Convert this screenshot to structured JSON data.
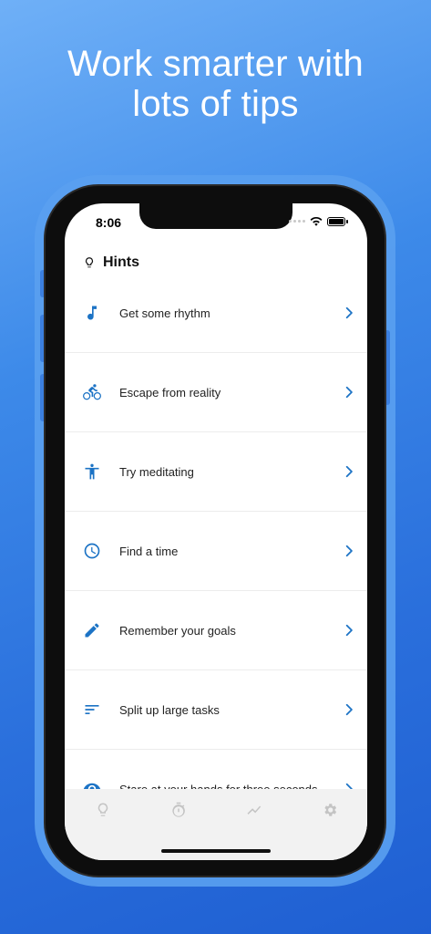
{
  "headline": {
    "line1": "Work smarter with",
    "line2": "lots of tips"
  },
  "status_bar": {
    "time": "8:06"
  },
  "screen": {
    "title": "Hints"
  },
  "hints": [
    {
      "label": "Get some rhythm",
      "icon": "music-note-icon"
    },
    {
      "label": "Escape from reality",
      "icon": "bicycle-icon"
    },
    {
      "label": "Try meditating",
      "icon": "person-icon"
    },
    {
      "label": "Find a time",
      "icon": "clock-icon"
    },
    {
      "label": "Remember your goals",
      "icon": "pencil-icon"
    },
    {
      "label": "Split up large tasks",
      "icon": "lines-icon"
    },
    {
      "label": "Stare at your hands for three seconds",
      "icon": "eye-icon"
    }
  ],
  "tabs": [
    {
      "icon": "lightbulb-icon"
    },
    {
      "icon": "stopwatch-icon"
    },
    {
      "icon": "trend-icon"
    },
    {
      "icon": "gear-icon"
    }
  ],
  "colors": {
    "accent": "#1c73c5",
    "background_gradient_start": "#6fb0f7",
    "background_gradient_end": "#1f5fd2",
    "tab_inactive": "#c4c4c4"
  }
}
